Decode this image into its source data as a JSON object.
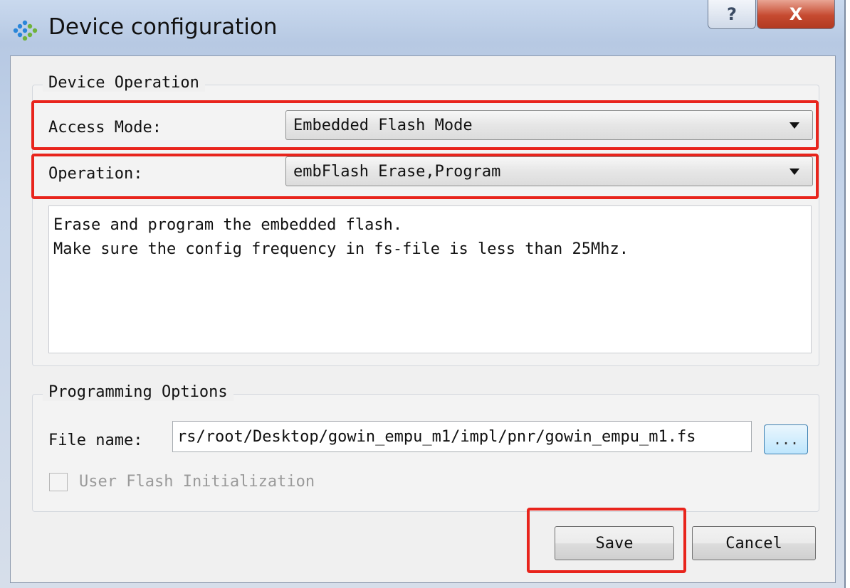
{
  "window": {
    "title": "Device configuration",
    "help_label": "?",
    "close_label": "X"
  },
  "device_operation": {
    "group_title": "Device Operation",
    "access_mode_label": "Access Mode:",
    "access_mode_value": "Embedded Flash Mode",
    "operation_label": "Operation:",
    "operation_value": "embFlash Erase,Program",
    "description": [
      "Erase and program the embedded flash.",
      "Make sure the config frequency in fs-file is less than 25Mhz."
    ]
  },
  "programming_options": {
    "group_title": "Programming Options",
    "file_name_label": "File name:",
    "file_name_value": "rs/root/Desktop/gowin_empu_m1/impl/pnr/gowin_empu_m1.fs",
    "browse_label": "...",
    "user_flash_label": "User Flash Initialization",
    "user_flash_checked": false
  },
  "buttons": {
    "save_label": "Save",
    "cancel_label": "Cancel"
  },
  "colors": {
    "highlight": "#e8241c",
    "close_button": "#c64a30",
    "browse_button": "#bee6fd"
  },
  "icons": {
    "app": "gowin-logo-icon",
    "dropdown": "chevron-down-icon"
  }
}
